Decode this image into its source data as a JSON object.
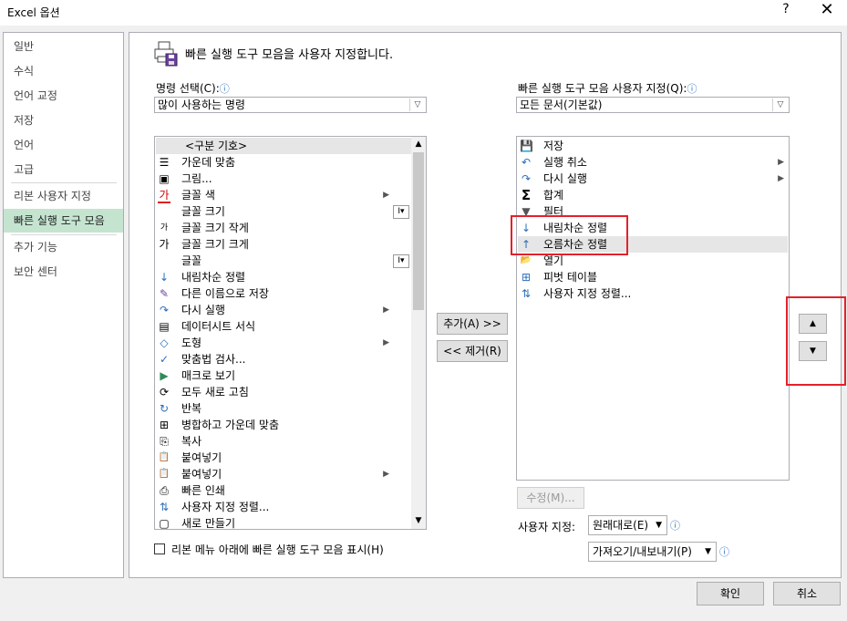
{
  "window": {
    "title": "Excel 옵션",
    "help": "?",
    "close": "✕"
  },
  "nav": [
    {
      "label": "일반"
    },
    {
      "label": "수식"
    },
    {
      "label": "언어 교정"
    },
    {
      "label": "저장"
    },
    {
      "label": "언어"
    },
    {
      "label": "고급"
    },
    {
      "label": "리본 사용자 지정"
    },
    {
      "label": "빠른 실행 도구 모음"
    },
    {
      "label": "추가 기능"
    },
    {
      "label": "보안 센터"
    }
  ],
  "header": {
    "title": "빠른 실행 도구 모음을 사용자 지정합니다."
  },
  "left": {
    "label": "명령 선택(C):",
    "combo_value": "많이 사용하는 명령",
    "items": [
      {
        "icon": "",
        "label": "<구분 기호>",
        "sub": ""
      },
      {
        "icon": "☰",
        "label": "가운데 맞춤",
        "sub": ""
      },
      {
        "icon": "▣",
        "label": "그림...",
        "sub": ""
      },
      {
        "icon": "가",
        "label": "글꼴 색",
        "sub": "▶"
      },
      {
        "icon": "",
        "label": "글꼴 크기",
        "sub": "I▾"
      },
      {
        "icon": "가",
        "label": "글꼴 크기 작게",
        "sub": ""
      },
      {
        "icon": "가",
        "label": "글꼴 크기 크게",
        "sub": ""
      },
      {
        "icon": "",
        "label": "글꼴",
        "sub": "I▾"
      },
      {
        "icon": "↓",
        "label": "내림차순 정렬",
        "sub": ""
      },
      {
        "icon": "✎",
        "label": "다른 이름으로 저장",
        "sub": ""
      },
      {
        "icon": "↷",
        "label": "다시 실행",
        "sub": "▶"
      },
      {
        "icon": "▤",
        "label": "데이터시트 서식",
        "sub": ""
      },
      {
        "icon": "◇",
        "label": "도형",
        "sub": "▶"
      },
      {
        "icon": "✓",
        "label": "맞춤법 검사...",
        "sub": ""
      },
      {
        "icon": "▶",
        "label": "매크로 보기",
        "sub": ""
      },
      {
        "icon": "⟳",
        "label": "모두 새로 고침",
        "sub": ""
      },
      {
        "icon": "↻",
        "label": "반복",
        "sub": ""
      },
      {
        "icon": "⊞",
        "label": "병합하고 가운데 맞춤",
        "sub": ""
      },
      {
        "icon": "⎘",
        "label": "복사",
        "sub": ""
      },
      {
        "icon": "📋",
        "label": "붙여넣기",
        "sub": ""
      },
      {
        "icon": "📋",
        "label": "붙여넣기",
        "sub": "▶"
      },
      {
        "icon": "⎙",
        "label": "빠른 인쇄",
        "sub": ""
      },
      {
        "icon": "⇅",
        "label": "사용자 지정 정렬...",
        "sub": ""
      },
      {
        "icon": "▢",
        "label": "새로 만들기",
        "sub": ""
      }
    ]
  },
  "right": {
    "label": "빠른 실행 도구 모음 사용자 지정(Q):",
    "combo_value": "모든 문서(기본값)",
    "items": [
      {
        "icon": "💾",
        "label": "저장",
        "sub": ""
      },
      {
        "icon": "↶",
        "label": "실행 취소",
        "sub": "▶"
      },
      {
        "icon": "↷",
        "label": "다시 실행",
        "sub": "▶"
      },
      {
        "icon": "Σ",
        "label": "합계",
        "sub": ""
      },
      {
        "icon": "▼",
        "label": "필터",
        "sub": ""
      },
      {
        "icon": "↓",
        "label": "내림차순 정렬",
        "sub": ""
      },
      {
        "icon": "↑",
        "label": "오름차순 정렬",
        "sub": ""
      },
      {
        "icon": "📂",
        "label": "열기",
        "sub": ""
      },
      {
        "icon": "⊞",
        "label": "피벗 테이블",
        "sub": ""
      },
      {
        "icon": "⇅",
        "label": "사용자 지정 정렬...",
        "sub": ""
      }
    ]
  },
  "buttons": {
    "add": "추가(A) >>",
    "remove": "<< 제거(R)",
    "modify": "수정(M)...",
    "up": "▲",
    "down": "▼",
    "ok": "확인",
    "cancel": "취소"
  },
  "custom": {
    "label": "사용자 지정:",
    "reset": "원래대로(E)",
    "import_export": "가져오기/내보내기(P)"
  },
  "checkbox": {
    "label": "리본 메뉴 아래에 빠른 실행 도구 모음 표시(H)"
  },
  "colors": {
    "accent_green": "#c5e4d0",
    "highlight_red": "#e5202a"
  }
}
